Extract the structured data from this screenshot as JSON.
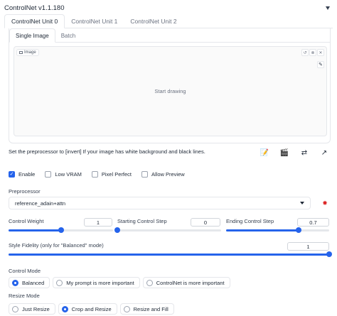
{
  "header": {
    "title": "ControlNet v1.1.180"
  },
  "unit_tabs": [
    {
      "label": "ControlNet Unit 0",
      "active": true
    },
    {
      "label": "ControlNet Unit 1",
      "active": false
    },
    {
      "label": "ControlNet Unit 2",
      "active": false
    }
  ],
  "image_tabs": [
    {
      "label": "Single Image",
      "active": true
    },
    {
      "label": "Batch",
      "active": false
    }
  ],
  "canvas": {
    "label": "Image",
    "placeholder": "Start drawing",
    "tools": [
      "undo-icon",
      "clear-icon",
      "close-icon"
    ],
    "edit_tool": "brush-icon"
  },
  "hint_text": "Set the preprocessor to [invert] If your image has white background and black lines.",
  "action_icons": [
    "notepad-icon",
    "camera-icon",
    "swap-icon",
    "arrow-upright-icon"
  ],
  "checkboxes": {
    "enable": {
      "label": "Enable",
      "checked": true
    },
    "low_vram": {
      "label": "Low VRAM",
      "checked": false
    },
    "pixel_perfect": {
      "label": "Pixel Perfect",
      "checked": false
    },
    "allow_preview": {
      "label": "Allow Preview",
      "checked": false
    }
  },
  "preprocessor": {
    "label": "Preprocessor",
    "value": "reference_adain+attn",
    "run_icon": "explosion-icon"
  },
  "sliders": {
    "control_weight": {
      "label": "Control Weight",
      "value": "1",
      "fraction": 0.5
    },
    "starting_step": {
      "label": "Starting Control Step",
      "value": "0",
      "fraction": 0.0
    },
    "ending_step": {
      "label": "Ending Control Step",
      "value": "0.7",
      "fraction": 0.7
    },
    "style_fidelity": {
      "label": "Style Fidelity (only for \"Balanced\" mode)",
      "value": "1",
      "fraction": 1.0
    }
  },
  "control_mode": {
    "label": "Control Mode",
    "options": [
      {
        "label": "Balanced",
        "selected": true
      },
      {
        "label": "My prompt is more important",
        "selected": false
      },
      {
        "label": "ControlNet is more important",
        "selected": false
      }
    ]
  },
  "resize_mode": {
    "label": "Resize Mode",
    "options": [
      {
        "label": "Just Resize",
        "selected": false
      },
      {
        "label": "Crop and Resize",
        "selected": true
      },
      {
        "label": "Resize and Fill",
        "selected": false
      }
    ]
  },
  "colors": {
    "accent": "#2563eb",
    "border": "#e5e7eb",
    "danger": "#dc2626"
  }
}
